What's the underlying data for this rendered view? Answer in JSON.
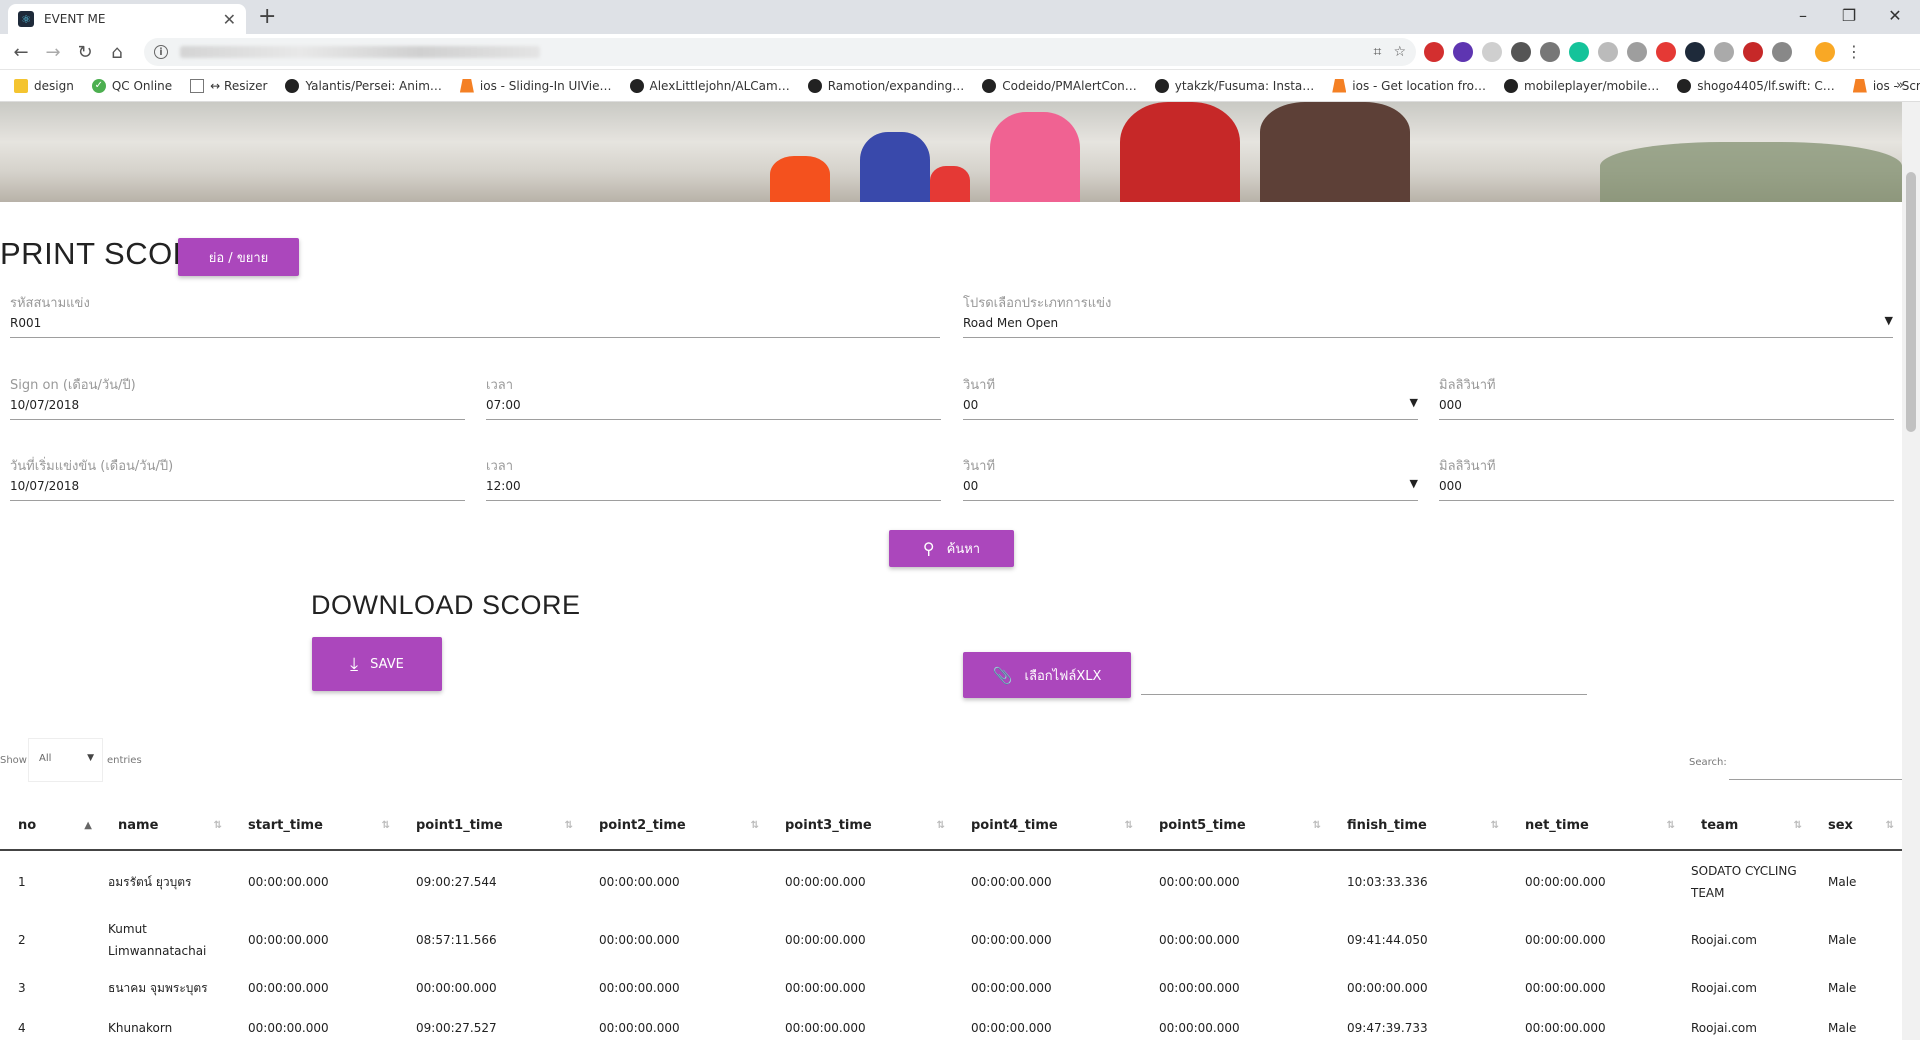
{
  "browser": {
    "tab_title": "EVENT ME",
    "bookmarks": [
      {
        "label": "design",
        "icon": "folder-icon"
      },
      {
        "label": "QC Online",
        "icon": "check-icon"
      },
      {
        "label": "↔ Resizer",
        "icon": "page-icon"
      },
      {
        "label": "Yalantis/Persei: Anim…",
        "icon": "github-icon"
      },
      {
        "label": "ios - Sliding-In UIVie…",
        "icon": "stackoverflow-icon"
      },
      {
        "label": "AlexLittlejohn/ALCam…",
        "icon": "github-icon"
      },
      {
        "label": "Ramotion/expanding…",
        "icon": "github-icon"
      },
      {
        "label": "Codeido/PMAlertCon…",
        "icon": "github-icon"
      },
      {
        "label": "ytakzk/Fusuma: Insta…",
        "icon": "github-icon"
      },
      {
        "label": "ios - Get location fro…",
        "icon": "stackoverflow-icon"
      },
      {
        "label": "mobileplayer/mobile…",
        "icon": "github-icon"
      },
      {
        "label": "shogo4405/lf.swift: C…",
        "icon": "github-icon"
      },
      {
        "label": "ios - ScrollView too s…",
        "icon": "stackoverflow-icon"
      }
    ],
    "bookmarks_overflow": "»"
  },
  "print_score": {
    "title": "PRINT SCORE",
    "toggle_label": "ย่อ / ขยาย",
    "race_code": {
      "label": "รหัสสนามแข่ง",
      "value": "R001"
    },
    "category": {
      "label": "โปรดเลือกประเภทการแข่ง",
      "value": "Road Men Open"
    },
    "sign_on": {
      "date": {
        "label": "Sign on (เดือน/วัน/ปี)",
        "value": "10/07/2018"
      },
      "time": {
        "label": "เวลา",
        "value": "07:00"
      },
      "seconds": {
        "label": "วินาที",
        "value": "00"
      },
      "millis": {
        "label": "มิลลิวินาที",
        "value": "000"
      }
    },
    "start": {
      "date": {
        "label": "วันที่เริ่มแข่งขัน (เดือน/วัน/ปี)",
        "value": "10/07/2018"
      },
      "time": {
        "label": "เวลา",
        "value": "12:00"
      },
      "seconds": {
        "label": "วินาที",
        "value": "00"
      },
      "millis": {
        "label": "มิลลิวินาที",
        "value": "000"
      }
    },
    "search_button": "ค้นหา"
  },
  "download_score": {
    "title": "DOWNLOAD SCORE",
    "save_button": "SAVE",
    "choose_file_button": "เลือกไฟล์XLX"
  },
  "datatable": {
    "show_label": "Show",
    "length_value": "All",
    "entries_label": "entries",
    "search_label": "Search:",
    "columns": [
      "no",
      "name",
      "start_time",
      "point1_time",
      "point2_time",
      "point3_time",
      "point4_time",
      "point5_time",
      "finish_time",
      "net_time",
      "team",
      "sex"
    ],
    "rows": [
      [
        "1",
        "อมรรัตน์ ยุวบุตร",
        "00:00:00.000",
        "09:00:27.544",
        "00:00:00.000",
        "00:00:00.000",
        "00:00:00.000",
        "00:00:00.000",
        "10:03:33.336",
        "00:00:00.000",
        "SODATO CYCLING TEAM",
        "Male"
      ],
      [
        "2",
        "Kumut Limwannatachai",
        "00:00:00.000",
        "08:57:11.566",
        "00:00:00.000",
        "00:00:00.000",
        "00:00:00.000",
        "00:00:00.000",
        "09:41:44.050",
        "00:00:00.000",
        "Roojai.com",
        "Male"
      ],
      [
        "3",
        "ธนาคม จุมพระบุตร",
        "00:00:00.000",
        "00:00:00.000",
        "00:00:00.000",
        "00:00:00.000",
        "00:00:00.000",
        "00:00:00.000",
        "00:00:00.000",
        "00:00:00.000",
        "Roojai.com",
        "Male"
      ],
      [
        "4",
        "Khunakorn",
        "00:00:00.000",
        "09:00:27.527",
        "00:00:00.000",
        "00:00:00.000",
        "00:00:00.000",
        "00:00:00.000",
        "09:47:39.733",
        "00:00:00.000",
        "Roojai.com",
        "Male"
      ]
    ]
  },
  "colors": {
    "accent": "#ab47bc",
    "chrome": "#dee1e6"
  }
}
